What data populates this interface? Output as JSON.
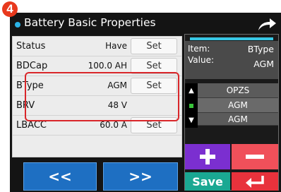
{
  "step_badge": "4",
  "header": {
    "title": "Battery Basic Properties",
    "share_icon": "share-arrow-icon"
  },
  "rows": [
    {
      "label": "Status",
      "value": "Have",
      "set_label": "Set",
      "has_set": true
    },
    {
      "label": "BDCap",
      "value": "100.0 AH",
      "set_label": "Set",
      "has_set": true
    },
    {
      "label": "BType",
      "value": "AGM",
      "set_label": "Set",
      "has_set": true
    },
    {
      "label": "BRV",
      "value": "48 V",
      "set_label": "",
      "has_set": false
    },
    {
      "label": "LBACC",
      "value": "60.0 A",
      "set_label": "Set",
      "has_set": true
    },
    {
      "label": "",
      "value": "",
      "set_label": "",
      "has_set": false
    }
  ],
  "nav": {
    "prev_label": "<<",
    "next_label": ">>"
  },
  "editor": {
    "item_key": "Item:",
    "item_value": "BType",
    "value_key": "Value:",
    "value_value": "AGM",
    "options": [
      "OPZS",
      "AGM",
      "AGM"
    ],
    "save_label": "Save",
    "plus_icon": "plus-icon",
    "minus_icon": "minus-icon",
    "enter_icon": "enter-return-icon"
  },
  "colors": {
    "accent_blue": "#1e6fc2",
    "highlight_red": "#d9262a",
    "plus_purple": "#7b2fd0",
    "minus_red": "#f0505a",
    "save_teal": "#1aa892"
  }
}
